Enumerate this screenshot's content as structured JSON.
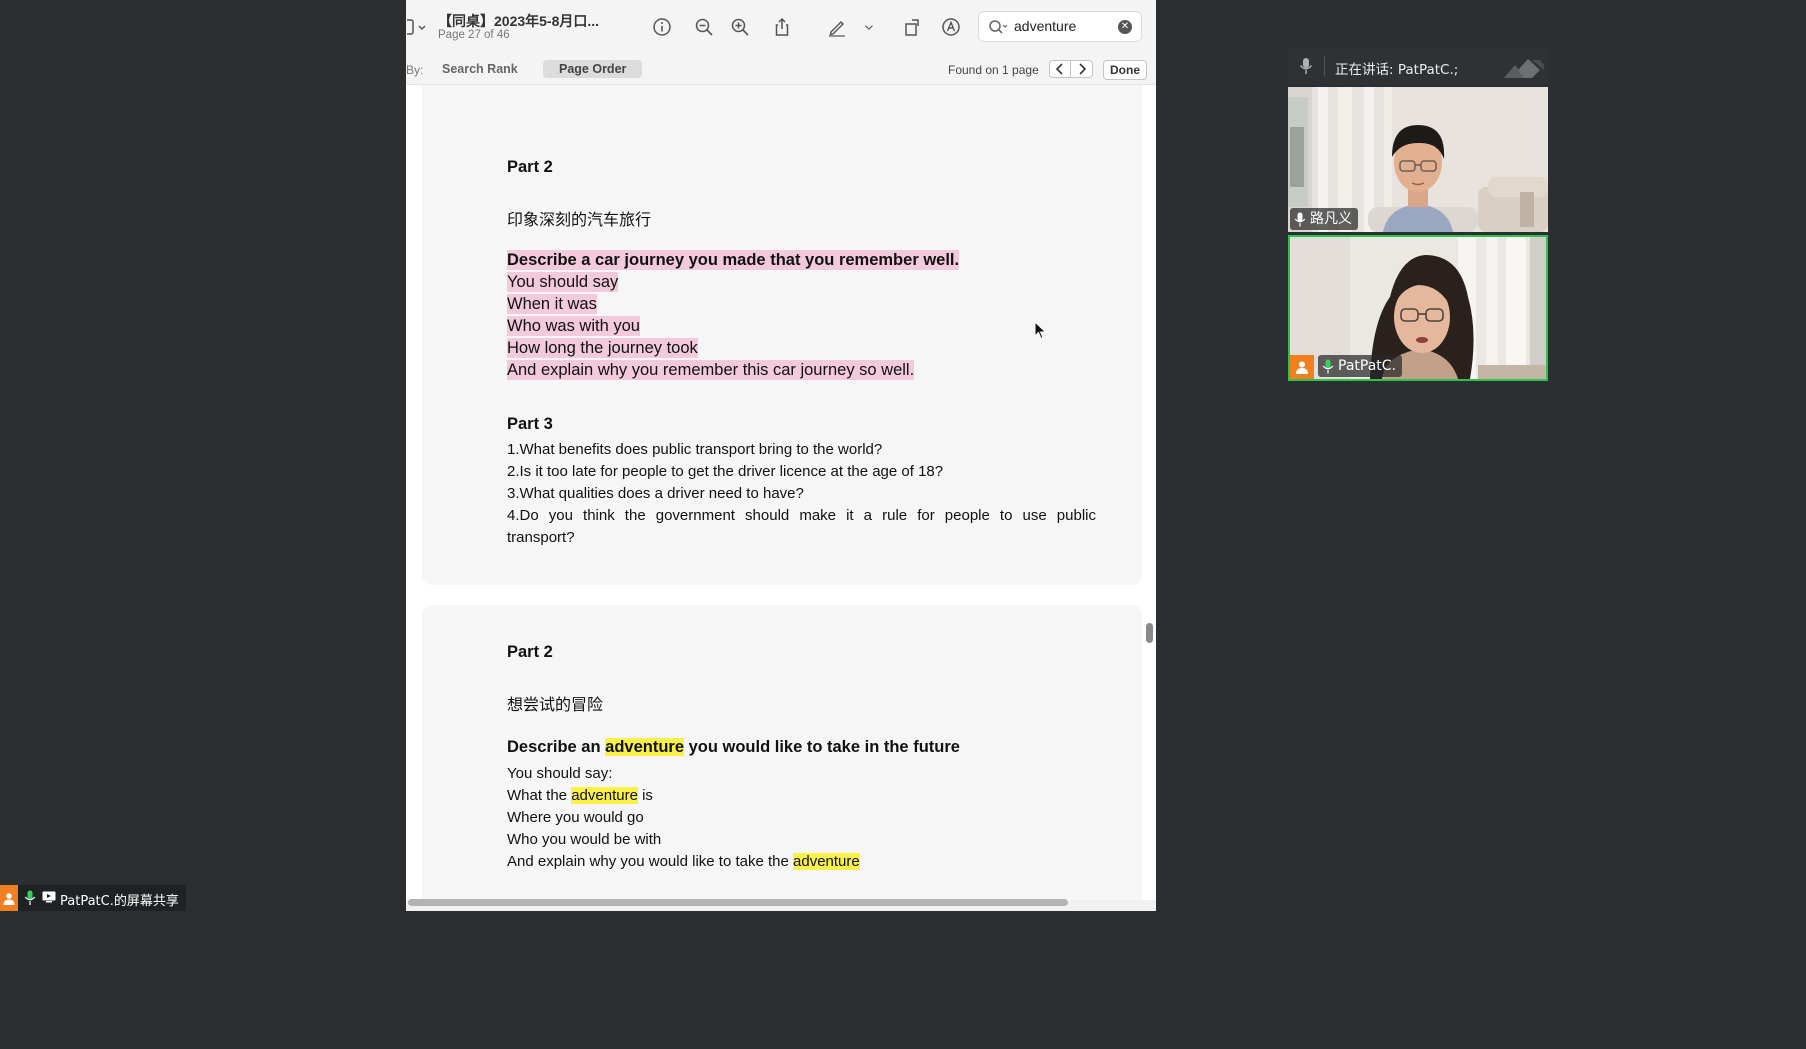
{
  "viewer": {
    "title": "【同桌】2023年5-8月口...",
    "page_indicator": "Page 27 of 46",
    "search": {
      "value": "adventure"
    },
    "findbar": {
      "sort_by_label": "By:",
      "search_rank_label": "Search Rank",
      "page_order_label": "Page Order",
      "found_label": "Found on 1 page",
      "done_label": "Done"
    }
  },
  "document": {
    "page_a": {
      "part2_heading": "Part 2",
      "cn_title": "印象深刻的汽车旅行",
      "cue_title": "Describe a car journey you made that you remember well.",
      "cue_lines": [
        "You should say",
        "When it was",
        "Who was with you",
        "How long the journey took",
        "And explain why you remember this car journey so well."
      ],
      "part3_heading": "Part 3",
      "questions": [
        "1.What benefits does public transport bring to the world?",
        "2.Is it too late for people to get the driver licence at the age of 18?",
        "3.What qualities does a driver need to have?",
        "4.Do you think the government should make it a rule for people to use public",
        "transport?"
      ]
    },
    "page_b": {
      "part2_heading": "Part 2",
      "cn_title": "想尝试的冒险",
      "cue_title_pre": "Describe an ",
      "cue_title_hl": "adventure",
      "cue_title_post": " you would like to take in the future",
      "line1": "You should say:",
      "line2_pre": "What the ",
      "line2_hl": "adventure",
      "line2_post": " is",
      "line3": "Where you would go",
      "line4": "Who you would be with",
      "line5_pre": "And explain why you would like to take the ",
      "line5_hl": "adventure"
    }
  },
  "meeting": {
    "speaker_label": "正在讲话:  PatPatC.;",
    "participants": [
      {
        "name": "路凡义"
      },
      {
        "name": "PatPatC."
      }
    ],
    "share_status": "PatPatC.的屏幕共享"
  },
  "colors": {
    "search_highlight": "#f9f04a",
    "annotation_highlight": "#f3c9dc",
    "active_speaker_border": "#2bc34d",
    "host_badge": "#f07f1f"
  }
}
